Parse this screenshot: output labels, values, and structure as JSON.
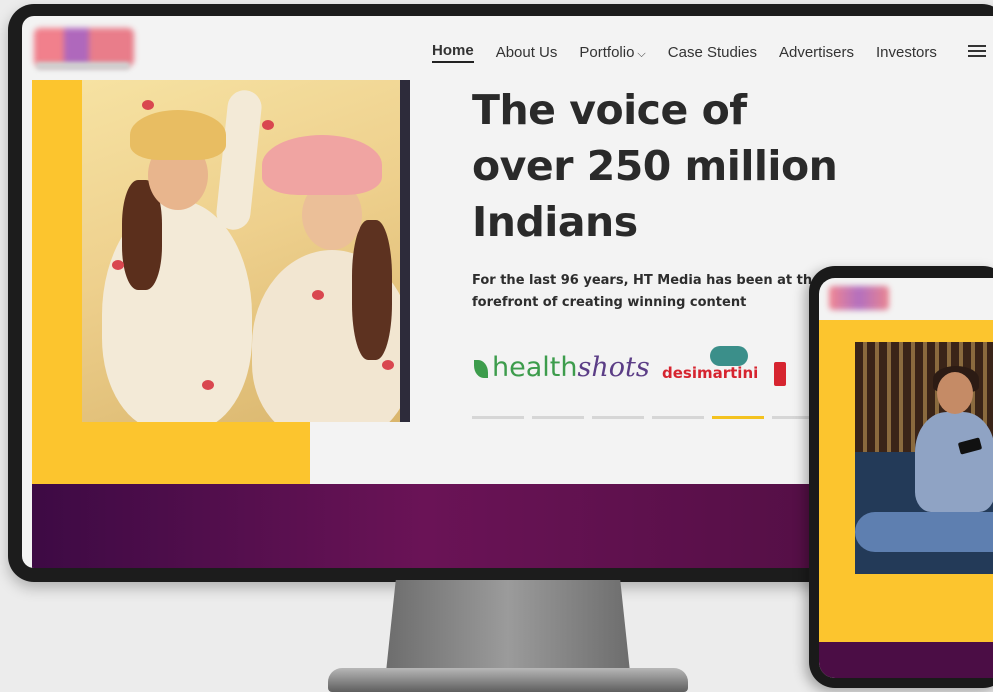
{
  "nav": {
    "items": [
      {
        "label": "Home",
        "active": true
      },
      {
        "label": "About Us"
      },
      {
        "label": "Portfolio",
        "dropdown": true
      },
      {
        "label": "Case Studies"
      },
      {
        "label": "Advertisers"
      },
      {
        "label": "Investors"
      }
    ],
    "menu_icon": "hamburger-menu-icon"
  },
  "hero": {
    "headline_line1": "The voice of",
    "headline_line2": "over 250 million",
    "headline_line3": "Indians",
    "subtext_line1": "For the last 96 years, HT Media has been at the",
    "subtext_line2": "forefront of creating winning content"
  },
  "brands": {
    "healthshots_a": "health",
    "healthshots_b": "shots",
    "desimartini": "desimartini"
  },
  "carousel": {
    "total": 6,
    "active_index": 4
  },
  "colors": {
    "accent_yellow": "#fcc52e",
    "band_purple": "#4a0d3e"
  }
}
